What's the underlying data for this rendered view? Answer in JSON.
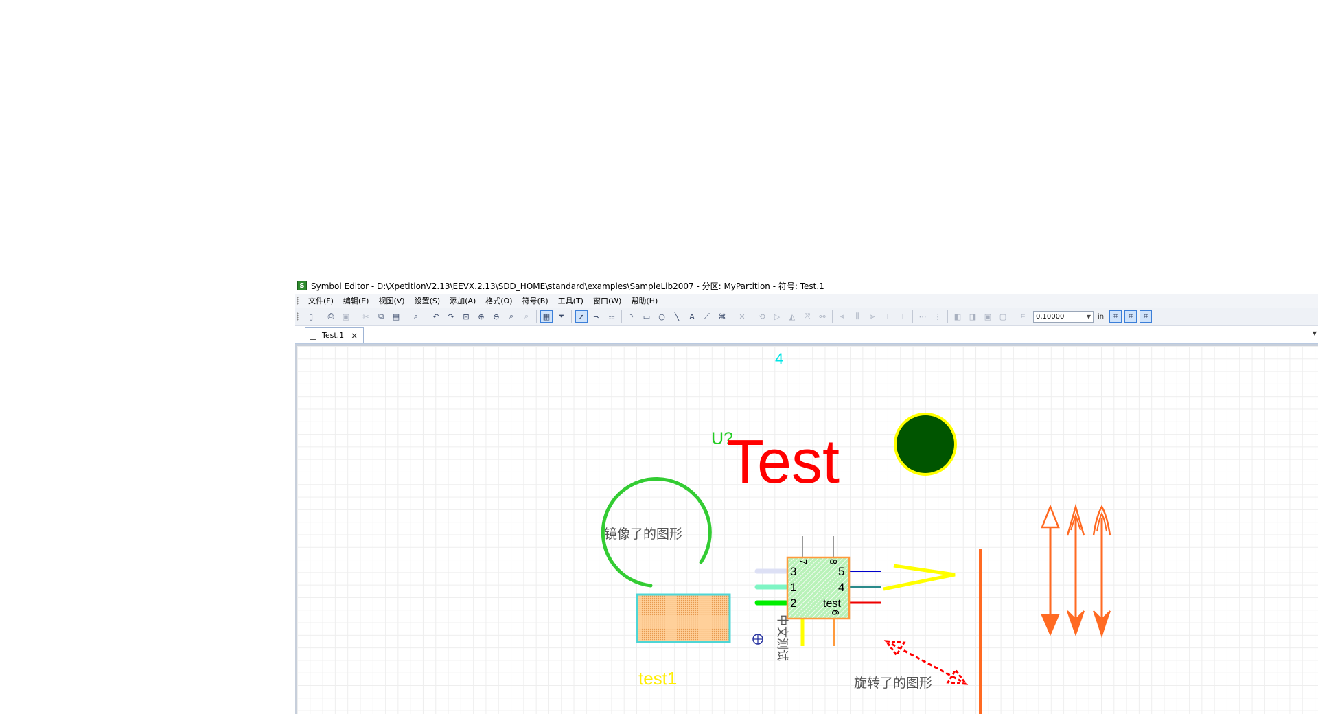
{
  "window": {
    "title": "Symbol Editor - D:\\XpetitionV2.13\\EEVX.2.13\\SDD_HOME\\standard\\examples\\SampleLib2007 - 分区: MyPartition - 符号: Test.1",
    "icon": "app-icon"
  },
  "menu": [
    {
      "label": "文件(F)"
    },
    {
      "label": "编辑(E)"
    },
    {
      "label": "视图(V)"
    },
    {
      "label": "设置(S)"
    },
    {
      "label": "添加(A)"
    },
    {
      "label": "格式(O)"
    },
    {
      "label": "符号(B)"
    },
    {
      "label": "工具(T)"
    },
    {
      "label": "窗口(W)"
    },
    {
      "label": "帮助(H)"
    }
  ],
  "toolbar": {
    "grid_value": "0.10000",
    "unit": "in"
  },
  "tabs": [
    {
      "label": "Test.1",
      "active": true
    }
  ],
  "canvas": {
    "top_pin_label": "4",
    "ref_designator": "U?",
    "title_text": "Test",
    "mirrored_label": "镜像了的图形",
    "rotated_label": "旋转了的图形",
    "vertical_label": "中文测试",
    "bottom_label": "test1",
    "pins": [
      {
        "number": "3",
        "side": "left"
      },
      {
        "number": "1",
        "side": "left"
      },
      {
        "number": "2",
        "side": "left"
      },
      {
        "number": "5",
        "side": "right"
      },
      {
        "number": "4",
        "side": "right"
      },
      {
        "number": "test",
        "side": "right"
      },
      {
        "number": "7",
        "side": "top"
      },
      {
        "number": "8",
        "side": "top"
      },
      {
        "number": "6",
        "side": "bottom"
      }
    ],
    "colors": {
      "ref_designator": "#22cc22",
      "title_text": "#ff0000",
      "top_pin_label": "#00e5e5",
      "bottom_label": "#ffee00",
      "body_fill": "#a8eea8",
      "body_border": "#ff9a3c",
      "circle_fill": "#005500",
      "circle_border": "#ffff00",
      "arc": "#33cc33",
      "arrows": "#ff6a22",
      "rotated_arrow": "#ff0000"
    }
  }
}
